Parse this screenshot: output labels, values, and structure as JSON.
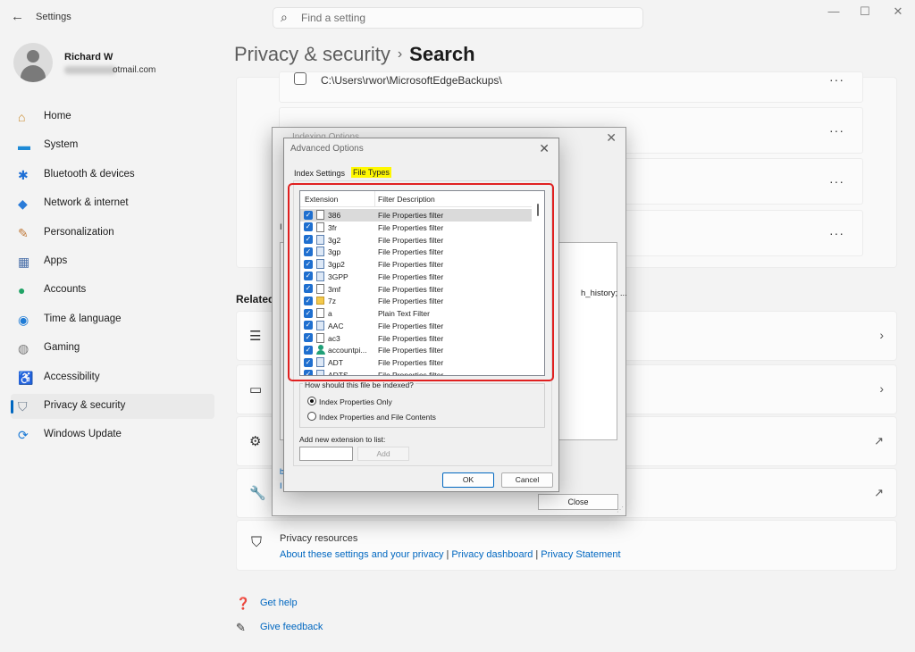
{
  "window": {
    "title": "Settings",
    "minimize": "—",
    "maximize": "☐",
    "close": "✕"
  },
  "search": {
    "placeholder": "Find a setting"
  },
  "user": {
    "name": "Richard W",
    "email_visible": "otmail.com"
  },
  "nav": {
    "items": [
      {
        "label": "Home",
        "icon": "home-icon",
        "selected": false
      },
      {
        "label": "System",
        "icon": "system-icon",
        "selected": false
      },
      {
        "label": "Bluetooth & devices",
        "icon": "bluetooth-icon",
        "selected": false
      },
      {
        "label": "Network & internet",
        "icon": "wifi-icon",
        "selected": false
      },
      {
        "label": "Personalization",
        "icon": "brush-icon",
        "selected": false
      },
      {
        "label": "Apps",
        "icon": "apps-icon",
        "selected": false
      },
      {
        "label": "Accounts",
        "icon": "accounts-icon",
        "selected": false
      },
      {
        "label": "Time & language",
        "icon": "globe-icon",
        "selected": false
      },
      {
        "label": "Gaming",
        "icon": "gamepad-icon",
        "selected": false
      },
      {
        "label": "Accessibility",
        "icon": "accessibility-icon",
        "selected": false
      },
      {
        "label": "Privacy & security",
        "icon": "shield-icon",
        "selected": true
      },
      {
        "label": "Windows Update",
        "icon": "update-icon",
        "selected": false
      }
    ]
  },
  "breadcrumb": {
    "parent": "Privacy & security",
    "separator": "›",
    "current": "Search"
  },
  "excluded_locations": {
    "rows": [
      {
        "path": "C:\\Users\\rwor\\MicrosoftEdgeBackups\\",
        "more": "···"
      },
      {
        "path": "",
        "more": "···"
      },
      {
        "path": "",
        "more": "···"
      },
      {
        "path": "",
        "more": "···"
      }
    ]
  },
  "related": {
    "heading": "Related"
  },
  "privacy_resources": {
    "title": "Privacy resources",
    "links": [
      "About these settings and your privacy",
      "Privacy dashboard",
      "Privacy Statement"
    ],
    "separator": "|"
  },
  "footer": {
    "get_help": "Get help",
    "give_feedback": "Give feedback"
  },
  "indexing_dialog": {
    "title": "Indexing Options",
    "partial_text": "h_history; ...",
    "left_fragment_1": "I",
    "left_fragment_2": "b",
    "left_fragment_3": "I",
    "close_button": "Close"
  },
  "advanced_dialog": {
    "title": "Advanced Options",
    "tabs": [
      "Index Settings",
      "File Types"
    ],
    "active_tab": "File Types",
    "columns": [
      "Extension",
      "Filter Description"
    ],
    "rows": [
      {
        "ext": "386",
        "desc": "File Properties filter",
        "checked": true,
        "selected": true,
        "icon": "file"
      },
      {
        "ext": "3fr",
        "desc": "File Properties filter",
        "checked": true,
        "selected": false,
        "icon": "file"
      },
      {
        "ext": "3g2",
        "desc": "File Properties filter",
        "checked": true,
        "selected": false,
        "icon": "media"
      },
      {
        "ext": "3gp",
        "desc": "File Properties filter",
        "checked": true,
        "selected": false,
        "icon": "media"
      },
      {
        "ext": "3gp2",
        "desc": "File Properties filter",
        "checked": true,
        "selected": false,
        "icon": "media"
      },
      {
        "ext": "3GPP",
        "desc": "File Properties filter",
        "checked": true,
        "selected": false,
        "icon": "media"
      },
      {
        "ext": "3mf",
        "desc": "File Properties filter",
        "checked": true,
        "selected": false,
        "icon": "file"
      },
      {
        "ext": "7z",
        "desc": "File Properties filter",
        "checked": true,
        "selected": false,
        "icon": "folder"
      },
      {
        "ext": "a",
        "desc": "Plain Text Filter",
        "checked": true,
        "selected": false,
        "icon": "file"
      },
      {
        "ext": "AAC",
        "desc": "File Properties filter",
        "checked": true,
        "selected": false,
        "icon": "media"
      },
      {
        "ext": "ac3",
        "desc": "File Properties filter",
        "checked": true,
        "selected": false,
        "icon": "file"
      },
      {
        "ext": "accountpi...",
        "desc": "File Properties filter",
        "checked": true,
        "selected": false,
        "icon": "person"
      },
      {
        "ext": "ADT",
        "desc": "File Properties filter",
        "checked": true,
        "selected": false,
        "icon": "media"
      },
      {
        "ext": "ADTS",
        "desc": "File Properties filter",
        "checked": true,
        "selected": false,
        "icon": "media"
      }
    ],
    "index_question": "How should this file be indexed?",
    "index_options": [
      "Index Properties Only",
      "Index Properties and File Contents"
    ],
    "index_selected": "Index Properties Only",
    "add_label": "Add new extension to list:",
    "add_input_value": "",
    "add_button": "Add",
    "ok_button": "OK",
    "cancel_button": "Cancel"
  },
  "colors": {
    "accent": "#0067c0",
    "highlight_box": "#e02020",
    "tab_highlight": "#fff800"
  }
}
